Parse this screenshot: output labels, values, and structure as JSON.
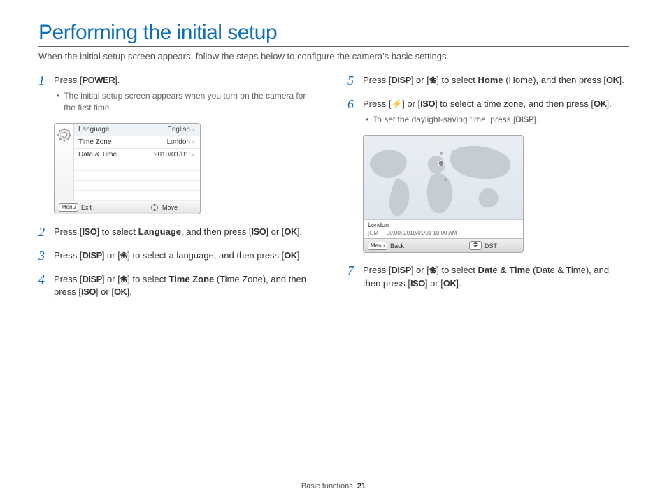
{
  "title": "Performing the initial setup",
  "intro": "When the initial setup screen appears, follow the steps below to configure the camera's basic settings.",
  "icons": {
    "power": "POWER",
    "iso": "ISO",
    "ok": "OK",
    "disp": "DISP",
    "macro": "❀",
    "flash": "⚡"
  },
  "steps_left": [
    {
      "n": "1",
      "parts": [
        "Press [",
        {
          "icon": "power"
        },
        "]."
      ],
      "bullet": "The initial setup screen appears when you turn on the camera for the first time."
    },
    {
      "n": "2",
      "parts": [
        "Press [",
        {
          "icon": "iso"
        },
        "] to select ",
        {
          "b": "Language"
        },
        ", and then press [",
        {
          "icon": "iso"
        },
        "] or [",
        {
          "icon": "ok"
        },
        "]."
      ]
    },
    {
      "n": "3",
      "parts": [
        "Press [",
        {
          "icon": "disp"
        },
        "] or [",
        {
          "icon": "macro"
        },
        "] to select a language, and then press [",
        {
          "icon": "ok"
        },
        "]."
      ]
    },
    {
      "n": "4",
      "parts": [
        "Press [",
        {
          "icon": "disp"
        },
        "] or [",
        {
          "icon": "macro"
        },
        "] to select ",
        {
          "b": "Time Zone"
        },
        " (Time Zone), and then press [",
        {
          "icon": "iso"
        },
        "] or [",
        {
          "icon": "ok"
        },
        "]."
      ]
    }
  ],
  "steps_right": [
    {
      "n": "5",
      "parts": [
        "Press [",
        {
          "icon": "disp"
        },
        "] or [",
        {
          "icon": "macro"
        },
        "] to select ",
        {
          "b": "Home"
        },
        " (Home), and then press [",
        {
          "icon": "ok"
        },
        "]."
      ]
    },
    {
      "n": "6",
      "parts": [
        "Press [",
        {
          "icon": "flash"
        },
        "] or [",
        {
          "icon": "iso"
        },
        "] to select a time zone, and then press [",
        {
          "icon": "ok"
        },
        "]."
      ],
      "bullet_parts": [
        "To set the daylight-saving time, press [",
        {
          "icon": "disp"
        },
        "]."
      ]
    },
    {
      "n": "7",
      "parts": [
        "Press [",
        {
          "icon": "disp"
        },
        "] or [",
        {
          "icon": "macro"
        },
        "] to select ",
        {
          "b": "Date & Time"
        },
        " (Date & Time), and then press [",
        {
          "icon": "iso"
        },
        "] or [",
        {
          "icon": "ok"
        },
        "]."
      ]
    }
  ],
  "menu_widget": {
    "rows": [
      {
        "label": "Language",
        "value": "English",
        "chev": "›",
        "hl": true
      },
      {
        "label": "Time Zone",
        "value": "London",
        "chev": "›"
      },
      {
        "label": "Date & Time",
        "value": "2010/01/01",
        "chev": "»"
      }
    ],
    "foot_left_btn": "Menu",
    "foot_left_label": "Exit",
    "foot_right_label": "Move"
  },
  "map_widget": {
    "city": "London",
    "gmt": "[GMT +00:00] 2010/01/01 10:00 AM",
    "foot_left_btn": "Menu",
    "foot_left_label": "Back",
    "foot_right_label": "DST"
  },
  "footer": {
    "section": "Basic functions",
    "page": "21"
  }
}
